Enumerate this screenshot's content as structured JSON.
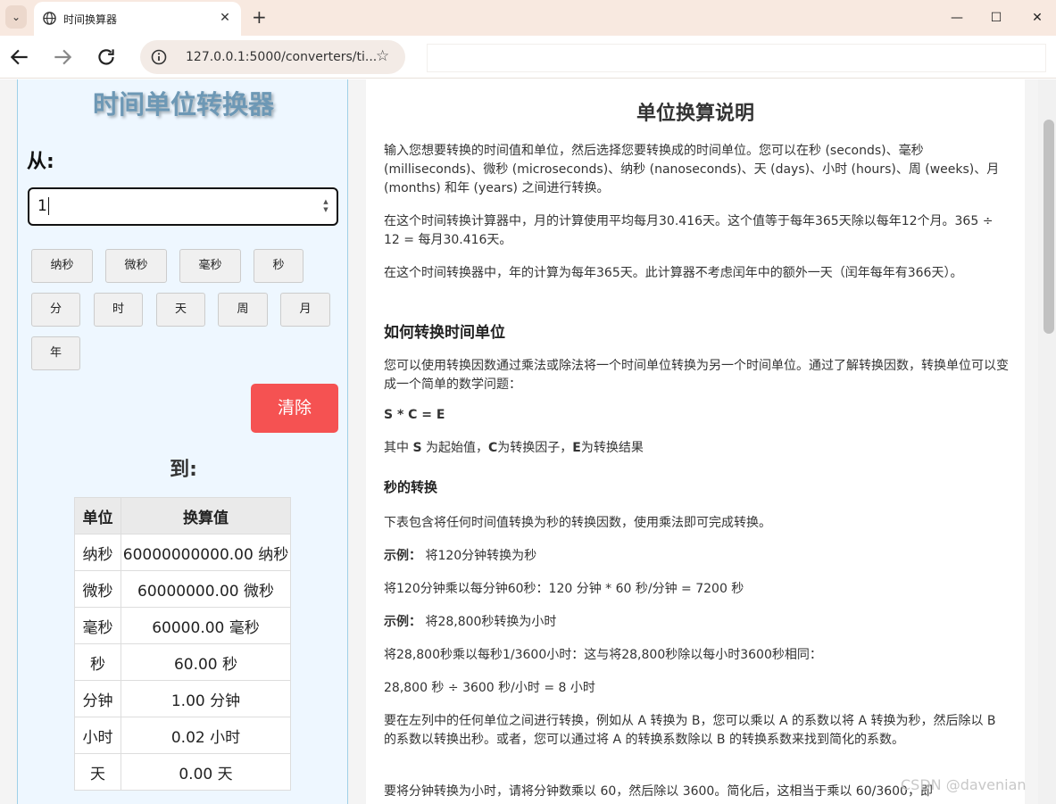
{
  "browser": {
    "tab_title": "时间换算器",
    "url": "127.0.0.1:5000/converters/ti...",
    "icons": [
      "tab-menu-icon",
      "globe-icon",
      "close-icon",
      "plus-icon",
      "minimize-icon",
      "maximize-icon",
      "back-icon",
      "forward-icon",
      "reload-icon",
      "site-info-icon",
      "star-icon"
    ]
  },
  "converter": {
    "title": "时间单位转换器",
    "from_label": "从:",
    "input_value": "1",
    "units": [
      "纳秒",
      "微秒",
      "毫秒",
      "秒",
      "分",
      "时",
      "天",
      "周",
      "月",
      "年"
    ],
    "clear_label": "清除",
    "to_label": "到:",
    "table": {
      "headers": [
        "单位",
        "换算值"
      ],
      "rows": [
        [
          "纳秒",
          "60000000000.00 纳秒"
        ],
        [
          "微秒",
          "60000000.00 微秒"
        ],
        [
          "毫秒",
          "60000.00 毫秒"
        ],
        [
          "秒",
          "60.00 秒"
        ],
        [
          "分钟",
          "1.00 分钟"
        ],
        [
          "小时",
          "0.02 小时"
        ],
        [
          "天",
          "0.00 天"
        ]
      ]
    },
    "colors": {
      "clear_button": "#f55252",
      "title": "#6d98b5"
    }
  },
  "article": {
    "title": "单位换算说明",
    "p1": "输入您想要转换的时间值和单位，然后选择您要转换成的时间单位。您可以在秒 (seconds)、毫秒 (milliseconds)、微秒 (microseconds)、纳秒 (nanoseconds)、天 (days)、小时 (hours)、周 (weeks)、月 (months) 和年 (years) 之间进行转换。",
    "p2": "在这个时间转换计算器中，月的计算使用平均每月30.416天。这个值等于每年365天除以每年12个月。365 ÷ 12 = 每月30.416天。",
    "p3": "在这个时间转换器中，年的计算为每年365天。此计算器不考虑闰年中的额外一天（闰年每年有366天）。",
    "h_how": "如何转换时间单位",
    "p4": "您可以使用转换因数通过乘法或除法将一个时间单位转换为另一个时间单位。通过了解转换因数，转换单位可以变成一个简单的数学问题：",
    "formula": "S * C = E",
    "where_1": "其中 ",
    "where_s": "S",
    "where_2": " 为起始值，",
    "where_c": "C",
    "where_3": "为转换因子，",
    "where_e": "E",
    "where_4": "为转换结果",
    "h_seconds": "秒的转换",
    "p5": "下表包含将任何时间值转换为秒的转换因数，使用乘法即可完成转换。",
    "ex_label": "示例：",
    "ex1": " 将120分钟转换为秒",
    "ex1_calc": "将120分钟乘以每分钟60秒：120 分钟 * 60 秒/分钟 = 7200 秒",
    "ex2": " 将28,800秒转换为小时",
    "ex2_calc": "将28,800秒乘以每秒1/3600小时：这与将28,800秒除以每小时3600秒相同：",
    "ex2_result": "28,800 秒 ÷ 3600 秒/小时 = 8 小时",
    "p6": "要在左列中的任何单位之间进行转换，例如从 A 转换为 B，您可以乘以 A 的系数以将 A 转换为秒，然后除以 B 的系数以转换出秒。或者，您可以通过将 A 的转换系数除以 B 的转换系数来找到简化的系数。",
    "p7": "要将分钟转换为小时，请将分钟数乘以 60，然后除以 3600。简化后，这相当于乘以 60/3600，即"
  },
  "watermark": "CSDN @davenian"
}
